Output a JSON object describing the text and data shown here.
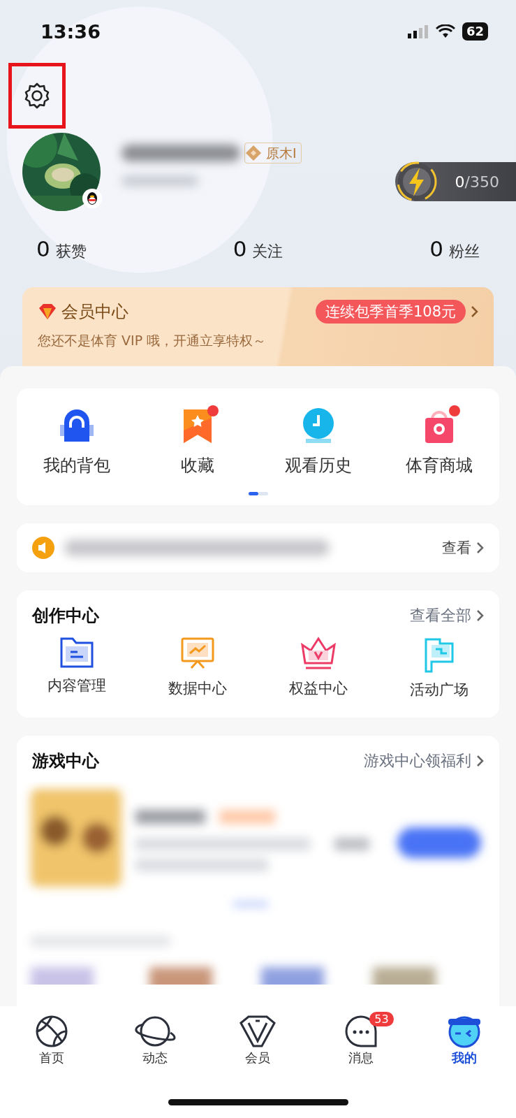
{
  "status_bar": {
    "time": "13:36",
    "battery": "62"
  },
  "profile": {
    "level_badge": "原木I",
    "energy": "**0**/350"
  },
  "stats": [
    {
      "value": "0",
      "label": "获赞"
    },
    {
      "value": "0",
      "label": "关注"
    },
    {
      "value": "0",
      "label": "粉丝"
    }
  ],
  "member": {
    "title": "会员中心",
    "offer": "连续包季首季108元",
    "subtitle": "您还不是体育 VIP 哦，开通立享特权～"
  },
  "shortcuts": {
    "items": [
      {
        "label": "我的背包",
        "kind": "bag",
        "dot": false
      },
      {
        "label": "收藏",
        "kind": "bookmark",
        "dot": true
      },
      {
        "label": "观看历史",
        "kind": "clock",
        "dot": false
      },
      {
        "label": "体育商城",
        "kind": "shop",
        "dot": true
      }
    ],
    "pages": [
      {
        "selected": true
      },
      {
        "selected": false
      }
    ]
  },
  "notice": {
    "action": "查看"
  },
  "creation": {
    "title": "创作中心",
    "more": "查看全部",
    "items": [
      {
        "label": "内容管理",
        "kind": "folder"
      },
      {
        "label": "数据中心",
        "kind": "chart"
      },
      {
        "label": "权益中心",
        "kind": "crown"
      },
      {
        "label": "活动广场",
        "kind": "flag"
      }
    ]
  },
  "games": {
    "title": "游戏中心",
    "more": "游戏中心领福利"
  },
  "tab_bar": [
    {
      "label": "首页",
      "kind": "ball",
      "selected": false
    },
    {
      "label": "动态",
      "kind": "planet",
      "selected": false
    },
    {
      "label": "会员",
      "kind": "diamond",
      "selected": false
    },
    {
      "label": "消息",
      "kind": "chat",
      "selected": false,
      "badge": "53"
    },
    {
      "label": "我的",
      "kind": "face",
      "selected": true
    }
  ]
}
